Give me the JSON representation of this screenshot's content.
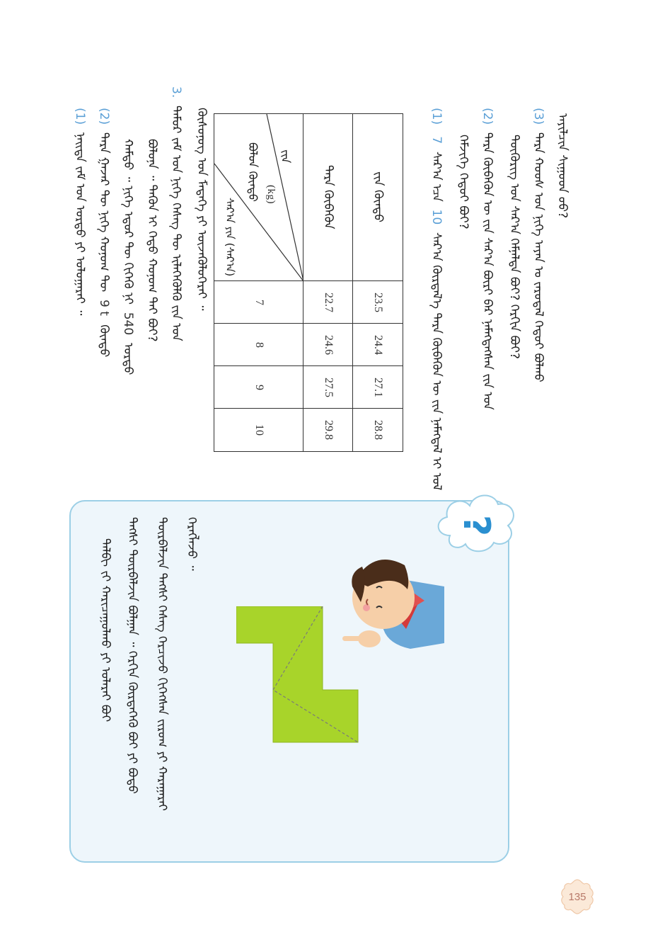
{
  "page_number": "135",
  "exercise_3_label": "3.",
  "sub_labels": {
    "p1": "(1)",
    "p2": "(2)",
    "p3": "(3)",
    "e3_1": "(1)",
    "e3_2": "(2)"
  },
  "inline_numbers": {
    "seven": "7",
    "ten": "10",
    "tons": "9 t",
    "amount": "540"
  },
  "table": {
    "header_top_label": "(kg)",
    "header_bottom_label": "( )",
    "row1_values": [
      "23.5",
      "24.4",
      "27.1",
      "28.8"
    ],
    "row2_values": [
      "22.7",
      "24.6",
      "27.5",
      "29.8"
    ],
    "column_headers": [
      "7",
      "8",
      "9",
      "10"
    ]
  },
  "colors": {
    "accent_blue": "#5a9fd6",
    "shape_green": "#a8d42a",
    "box_bg": "#eef6fb",
    "box_border": "#9ccfe6"
  }
}
